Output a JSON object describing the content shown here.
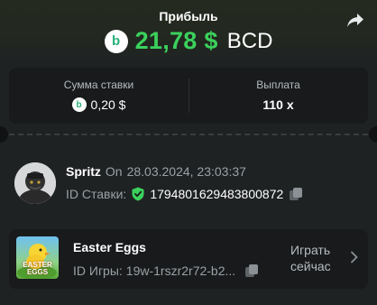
{
  "header": {
    "title": "Прибыль",
    "profit_value": "21,78 $",
    "currency": "BCD",
    "coin_icon": "bcd-coin-icon",
    "share_icon": "share-arrow-icon",
    "profit_color": "#3bd15c"
  },
  "stats": {
    "bet_amount_label": "Сумма ставки",
    "bet_amount_value": "0,20 $",
    "payout_label": "Выплата",
    "payout_value": "110 x"
  },
  "player": {
    "name": "Spritz",
    "on_label": "On",
    "datetime": "28.03.2024, 23:03:37",
    "bet_id_label": "ID Ставки:",
    "bet_id": "1794801629483800872"
  },
  "game": {
    "title": "Easter Eggs",
    "thumb_text": "EASTER EGGS",
    "game_id_label": "ID Игры:",
    "game_id": "19w-1rszr2r72-b2...",
    "play_label": "Играть сейчас"
  }
}
